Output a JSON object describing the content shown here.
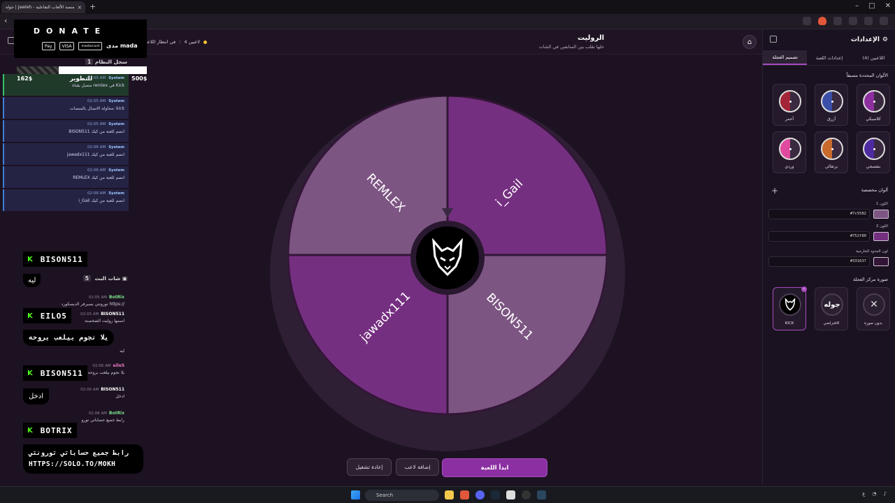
{
  "browser": {
    "tab_title": "جولة | Jawleh - منصة الألعاب التفاعلية",
    "tab_close": "×",
    "new_tab": "+",
    "back": "‹"
  },
  "app": {
    "title": "الروليت",
    "subtitle": "خلها تقلب بين المتابعين في الشات",
    "home_icon": "⌂",
    "player_count": "4 لاعبين",
    "waiting": "في انتظار اللاعبين"
  },
  "wheel": {
    "segments": [
      {
        "name": "REMLEX",
        "color": "#7c5582"
      },
      {
        "name": "i_Gail",
        "color": "#752f80"
      },
      {
        "name": "BISON511",
        "color": "#7c5582"
      },
      {
        "name": "jawadx111",
        "color": "#752f80"
      }
    ],
    "border_color": "#331637"
  },
  "buttons": {
    "start": "ابدأ اللعبة",
    "add_player": "إضافة لاعب",
    "replay": "إعادة تشغيل"
  },
  "donate": {
    "title": "DONATE",
    "methods": [
      "Pay",
      "VISA",
      "mastercard",
      "مدى mada"
    ],
    "goal_current": "162$",
    "goal_label": "للتطوير",
    "goal_target": "500$",
    "goal_progress": 0.32
  },
  "log": {
    "title": "سجل النظام",
    "count": "1",
    "items": [
      {
        "source": "System",
        "time": "02:05 AM",
        "msg": "متصل بقناة remlex في Kick"
      },
      {
        "source": "System",
        "time": "02:05 AM",
        "msg": "محاولة الاتصال بالمنصات: kick"
      },
      {
        "source": "System",
        "time": "02:05 AM",
        "msg": "BISON511 انضم للعبة من كيك"
      },
      {
        "source": "System",
        "time": "02:06 AM",
        "msg": "jawadx111 انضم للعبة من كيك"
      },
      {
        "source": "System",
        "time": "02:06 AM",
        "msg": "REMLEX انضم للعبة من كيك"
      },
      {
        "source": "System",
        "time": "02:06 AM",
        "msg": "i_Gail انضم للعبة من كيك"
      }
    ]
  },
  "chat": {
    "title": "شات البث",
    "count": "5",
    "messages": [
      {
        "user": "BotRix",
        "time": "02:05 AM",
        "msg": "تورونتي بسيرفر الديسكورد https://"
      },
      {
        "user": "BISON511",
        "time": "02:05 AM",
        "msg": "اسمها روليت الشخصنة"
      },
      {
        "user": "",
        "time": "",
        "msg": "ليه"
      },
      {
        "user": "eilo5",
        "time": "02:06 AM",
        "msg": "يلا نجوم بيلعب بروحه"
      },
      {
        "user": "BISON511",
        "time": "02:06 AM",
        "msg": "ادخل"
      },
      {
        "user": "BotRix",
        "time": "02:06 AM",
        "msg": "رابط جميع حساباتي تورو"
      }
    ]
  },
  "overlay": {
    "entries": [
      {
        "name": "BISON511",
        "msg": "ليه"
      },
      {
        "name": "EILO5",
        "msg": "يلا نجوم بيلعب بروحه"
      },
      {
        "name": "BISON511",
        "msg": "ادخل"
      },
      {
        "name": "BOTRIX",
        "msg": "رابط جميع حساباتي تورونتي"
      }
    ],
    "link": "HTTPS://SOLO.TO/MOKH"
  },
  "settings": {
    "title": "الإعدادات",
    "tabs": [
      "اللاعبين (4)",
      "إعدادات اللعبة",
      "تصميم العجلة"
    ],
    "active_tab": "تصميم العجلة",
    "presets_title": "الألوان المحددة مسبقاً",
    "presets": [
      {
        "label": "كلاسيكي",
        "color": "#8e2fa0"
      },
      {
        "label": "أزرق",
        "color": "#3b4fa8"
      },
      {
        "label": "أحمر",
        "color": "#a32437"
      },
      {
        "label": "بنفسجي",
        "color": "#4e2aa0"
      },
      {
        "label": "برتقالي",
        "color": "#c86a2c"
      },
      {
        "label": "وردي",
        "color": "#e04a9e"
      }
    ],
    "custom_title": "ألوان مخصصة",
    "color1_label": "اللون 1",
    "color1": "#7c5582",
    "color2_label": "اللون 2",
    "color2": "#752f80",
    "border_label": "لون الحدود الخارجية",
    "border": "#331637",
    "center_title": "صورة مركز العجلة",
    "center_options": [
      {
        "label": "KICK",
        "selected": true
      },
      {
        "label": "الافتراضي",
        "selected": false
      },
      {
        "label": "بدون صورة",
        "selected": false
      }
    ],
    "default_logo_text": "جوله"
  },
  "taskbar": {
    "search": "Search",
    "tray_lang": "ع",
    "tray_time": ""
  }
}
